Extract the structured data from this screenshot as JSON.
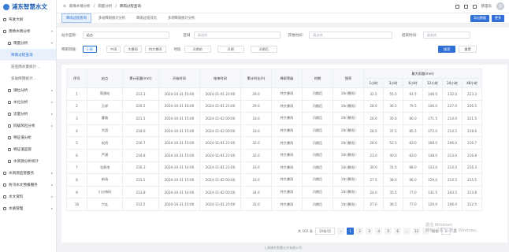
{
  "app": {
    "title": "浦东智慧水文",
    "avatar": "管"
  },
  "sidebar": {
    "items": [
      {
        "label": "驾驶大屏",
        "level": 0
      },
      {
        "label": "雨情水情分析",
        "level": 0,
        "arrow": "▾"
      },
      {
        "label": "雨量分析",
        "level": 1,
        "arrow": "▾"
      },
      {
        "label": "降雨过程查询",
        "level": 2,
        "active": true
      },
      {
        "label": "前后雨水量统计…",
        "level": 2
      },
      {
        "label": "多站降雨统计…",
        "level": 2
      },
      {
        "label": "潮位分析",
        "level": 1,
        "arrow": "▸"
      },
      {
        "label": "水位分析",
        "level": 1,
        "arrow": "▸"
      },
      {
        "label": "流量分析",
        "level": 1,
        "arrow": "▸"
      },
      {
        "label": "同级风险分析",
        "level": 1,
        "arrow": "▸"
      },
      {
        "label": "特征值分析",
        "level": 1
      },
      {
        "label": "特征值监管",
        "level": 1
      },
      {
        "label": "水资源分析统计",
        "level": 1
      },
      {
        "label": "水资源监管服务",
        "level": 0,
        "arrow": "▸"
      },
      {
        "label": "防汛水文预报服务",
        "level": 0,
        "arrow": "▸"
      },
      {
        "label": "水文资料",
        "level": 0,
        "arrow": "▸"
      },
      {
        "label": "水质管理",
        "level": 0,
        "arrow": "▸"
      }
    ]
  },
  "header": {
    "crumbs": [
      "雨情水情分析",
      "雨量分析",
      "降雨过程查询"
    ],
    "user": "管理员"
  },
  "tabs": {
    "items": [
      "降雨过程查询",
      "多站降雨统计分析",
      "降雨过程对比",
      "多场降雨统计分析"
    ],
    "btn1": "导出数据",
    "btn2": "更多"
  },
  "filters": {
    "station_label": "站点名称：",
    "station_value": "站点",
    "area_label": "区域",
    "area_placeholder": "请选择",
    "start_label": "开始时间：",
    "start_placeholder": "请选择",
    "end_label": "结束时间：",
    "end_placeholder": "请选择",
    "rain_label": "降雨等级：",
    "rain_levels": [
      "小雨",
      "中雨",
      "大暴雨",
      "特大暴雨"
    ],
    "time_label": "时段",
    "periods": [
      "汛期前",
      "汛期",
      "汛期后"
    ],
    "search": "搜索",
    "reset": "重置"
  },
  "table": {
    "headers": [
      "序号",
      "站点",
      "累计雨量(mm)",
      "开始时间",
      "结束时间",
      "累计时长(h)",
      "降雨等级",
      "时期",
      "频率"
    ],
    "group_header": "最大雨量(mm)",
    "sub_headers": [
      "1小时",
      "3小时",
      "6小时",
      "12小时",
      "24小时",
      "48小时"
    ],
    "rows": [
      [
        "1",
        "周浦站",
        "223.3",
        "2024-10-31 15:00",
        "2024-11-01 23:00",
        "29.0",
        "特大暴雨",
        "汛期后",
        "1年(暴雨)",
        "32.5",
        "55.5",
        "91.5",
        "146.0",
        "232.0",
        "223.3"
      ],
      [
        "2",
        "万祥",
        "226.5",
        "2024-10-31 16:00",
        "2024-11-01 21:00",
        "29.0",
        "特大暴雨",
        "汛期后",
        "1年(暴雨)",
        "28.0",
        "36.5",
        "79.5",
        "146.0",
        "227.0",
        "226.5"
      ],
      [
        "3",
        "曹路",
        "221.5",
        "2024-10-31 15:00",
        "2024-11-02 00:00",
        "33.0",
        "特大暴雨",
        "汛期后",
        "1年(暴雨)",
        "26.0",
        "35.6",
        "80.0",
        "171.5",
        "214.0",
        "221.5"
      ],
      [
        "4",
        "大团",
        "218.6",
        "2024-10-31 15:00",
        "2024-11-02 00:00",
        "33.0",
        "特大暴雨",
        "汛期后",
        "1年(暴雨)",
        "28.5",
        "37.5",
        "85.5",
        "172.0",
        "214.5",
        "218.6"
      ],
      [
        "5",
        "祝桥",
        "216.7",
        "2024-10-31 15:00",
        "2024-11-01 23:00",
        "32.0",
        "特大暴雨",
        "汛期后",
        "1年(暴雨)",
        "28.0",
        "52.5",
        "83.0",
        "168.0",
        "206.0",
        "216.7"
      ],
      [
        "6",
        "芦潮",
        "216.8",
        "2024-10-31 15:00",
        "2024-11-01 23:00",
        "32.0",
        "特大暴雨",
        "汛期后",
        "1年(暴雨)",
        "23.0",
        "40.0",
        "83.0",
        "138.0",
        "213.0",
        "216.8"
      ],
      [
        "7",
        "北蔡南",
        "216.3",
        "2024-10-31 14:00",
        "2024-11-01 23:00",
        "33.0",
        "特大暴雨",
        "汛期后",
        "1年(暴雨)",
        "30.0",
        "31.5",
        "88.0",
        "133.0",
        "214.0",
        "216.3"
      ],
      [
        "8",
        "新场",
        "215.5",
        "2024-10-31 15:00",
        "2024-11-02 00:00",
        "33.0",
        "特大暴雨",
        "汛期后",
        "1年(暴雨)",
        "27.5",
        "38.0",
        "96.0",
        "129.0",
        "214.5",
        "215.5"
      ],
      [
        "9",
        "川沙南码",
        "213.8",
        "2024-10-31 14:00",
        "2024-11-02 00:00",
        "34.0",
        "特大暴雨",
        "汛期后",
        "1年(暴雨)",
        "24.0",
        "35.5",
        "77.0",
        "131.5",
        "203.5",
        "213.8"
      ],
      [
        "10",
        "六灶",
        "212.5",
        "2024-10-31 15:00",
        "2024-11-01 23:00",
        "32.0",
        "特大暴雨",
        "汛期后",
        "1年(暴雨)",
        "27.0",
        "36.5",
        "77.0",
        "129.0",
        "206.0",
        "212.5"
      ]
    ]
  },
  "pager": {
    "total": "共 101 条",
    "size": "10条/页",
    "prev": "‹",
    "pages": [
      "1",
      "2",
      "3",
      "4",
      "5",
      "6",
      "…",
      "11"
    ],
    "next": "›",
    "goto": "前往",
    "goto_value": "1",
    "goto_suffix": "页"
  },
  "footer": "上海浦东智慧水文有限公司",
  "watermark": {
    "line1": "激活 Windows",
    "line2": "转到“设置”以激活 Windows。"
  }
}
